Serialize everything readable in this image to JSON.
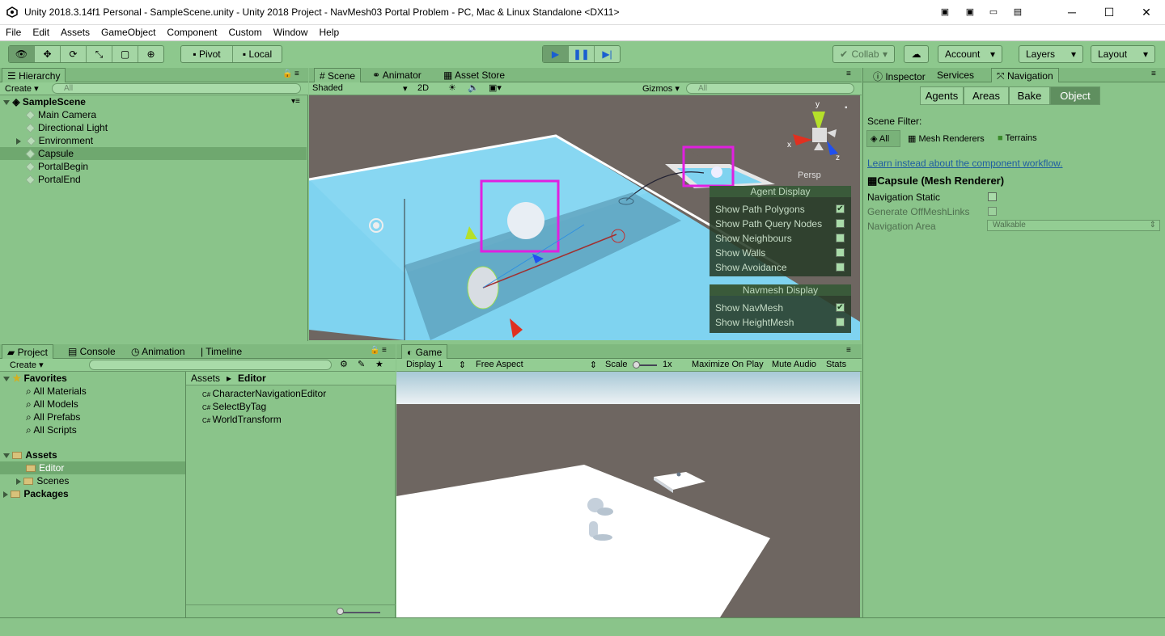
{
  "window": {
    "title": "Unity 2018.3.14f1 Personal - SampleScene.unity - Unity 2018 Project - NavMesh03 Portal Problem - PC, Mac & Linux Standalone <DX11>"
  },
  "menu": [
    "File",
    "Edit",
    "Assets",
    "GameObject",
    "Component",
    "Custom",
    "Window",
    "Help"
  ],
  "toolbar": {
    "pivot": "Pivot",
    "local": "Local",
    "collab": "Collab",
    "account": "Account",
    "layers": "Layers",
    "layout": "Layout"
  },
  "hierarchy": {
    "tab": "Hierarchy",
    "create": "Create",
    "search": "All",
    "scene": "SampleScene",
    "items": [
      "Main Camera",
      "Directional Light",
      "Environment",
      "Capsule",
      "PortalBegin",
      "PortalEnd"
    ]
  },
  "scene": {
    "tabs": [
      "Scene",
      "Animator",
      "Asset Store"
    ],
    "shading": "Shaded",
    "mode2d": "2D",
    "gizmos": "Gizmos",
    "search": "All",
    "persp": "Persp",
    "axis_y": "y",
    "axis_x": "x",
    "axis_z": "z",
    "agent_display": {
      "title": "Agent Display",
      "rows": [
        {
          "label": "Show Path Polygons",
          "checked": true
        },
        {
          "label": "Show Path Query Nodes",
          "checked": false
        },
        {
          "label": "Show Neighbours",
          "checked": false
        },
        {
          "label": "Show Walls",
          "checked": false
        },
        {
          "label": "Show Avoidance",
          "checked": false
        }
      ]
    },
    "navmesh_display": {
      "title": "Navmesh Display",
      "rows": [
        {
          "label": "Show NavMesh",
          "checked": true
        },
        {
          "label": "Show HeightMesh",
          "checked": false
        }
      ]
    }
  },
  "inspector": {
    "tabs": [
      "Inspector",
      "Services",
      "Navigation"
    ],
    "nav_tabs": [
      "Agents",
      "Areas",
      "Bake",
      "Object"
    ],
    "scene_filter_label": "Scene Filter:",
    "filters": [
      "All",
      "Mesh Renderers",
      "Terrains"
    ],
    "link": "Learn instead about the component workflow.",
    "object_title": "Capsule (Mesh Renderer)",
    "nav_static": "Navigation Static",
    "gen_links": "Generate OffMeshLinks",
    "nav_area": "Navigation Area",
    "nav_area_value": "Walkable"
  },
  "project": {
    "tabs": [
      "Project",
      "Console",
      "Animation",
      "Timeline"
    ],
    "create": "Create",
    "favorites": "Favorites",
    "fav_items": [
      "All Materials",
      "All Models",
      "All Prefabs",
      "All Scripts"
    ],
    "assets": "Assets",
    "asset_items": [
      "Editor",
      "Scenes"
    ],
    "packages": "Packages",
    "breadcrumb": [
      "Assets",
      "Editor"
    ],
    "files": [
      "CharacterNavigationEditor",
      "SelectByTag",
      "WorldTransform"
    ]
  },
  "game": {
    "tab": "Game",
    "display": "Display 1",
    "aspect": "Free Aspect",
    "scale_label": "Scale",
    "scale_value": "1x",
    "maximize": "Maximize On Play",
    "mute": "Mute Audio",
    "stats": "Stats"
  },
  "colors": {
    "panel": "#8ac48a",
    "highlight": "#e020e0",
    "navmesh": "#7fd3f0"
  }
}
